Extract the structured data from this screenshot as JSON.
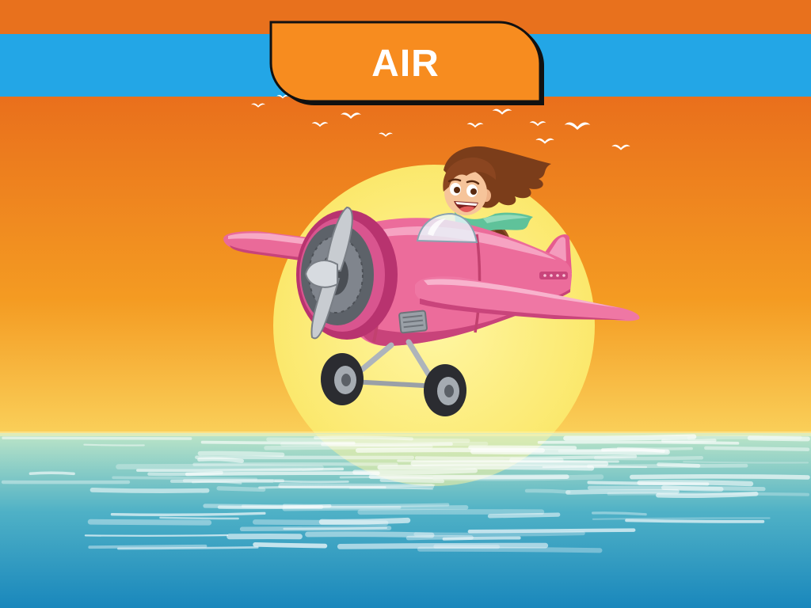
{
  "banner": {
    "label": "AIR"
  },
  "colors": {
    "top_strip": "#e8711d",
    "blue_band": "#23a6e6",
    "banner_fill": "#f78c1f",
    "banner_outline": "#111111",
    "banner_text": "#ffffff",
    "sky_top": "#e96f1c",
    "sky_mid": "#f49b22",
    "sky_horizon": "#fad05a",
    "sun_center": "#fff6a2",
    "sun_edge": "#fbe86c",
    "sea_top": "#bde5c7",
    "sea_mid": "#4fb1c6",
    "sea_bottom": "#1987bc",
    "plane_body": "#ec6c9b",
    "plane_cowl": "#b8336f",
    "scarf": "#5fc29a",
    "hair": "#7b3d1a"
  },
  "icons": [
    "sun-icon",
    "bird-icon",
    "airplane-icon",
    "pilot-kid-icon",
    "wave-icon"
  ]
}
